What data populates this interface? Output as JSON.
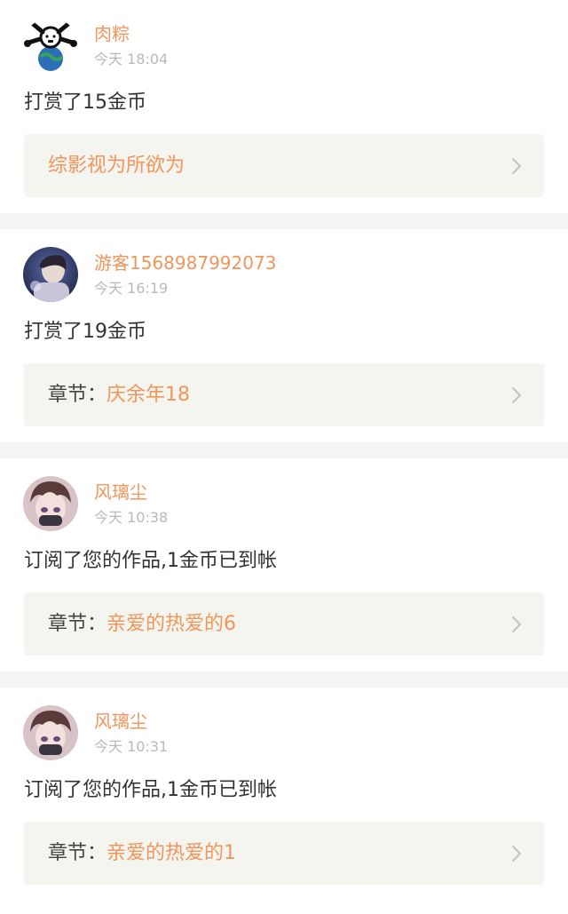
{
  "feed": [
    {
      "user": "肉粽",
      "time": "今天 18:04",
      "action": "打赏了15金币",
      "link_prefix": "",
      "link_title": "综影视为所欲为",
      "avatar_icon": "cartoon-earth-avatar-icon"
    },
    {
      "user": "游客1568987992073",
      "time": "今天 16:19",
      "action": "打赏了19金币",
      "link_prefix": "章节：",
      "link_title": "庆余年18",
      "avatar_icon": "portrait-avatar-icon"
    },
    {
      "user": "风璃尘",
      "time": "今天 10:38",
      "action": "订阅了您的作品,1金币已到帐",
      "link_prefix": "章节：",
      "link_title": "亲爱的热爱的6",
      "avatar_icon": "anime-avatar-icon"
    },
    {
      "user": "风璃尘",
      "time": "今天 10:31",
      "action": "订阅了您的作品,1金币已到帐",
      "link_prefix": "章节：",
      "link_title": "亲爱的热爱的1",
      "avatar_icon": "anime-avatar-icon"
    }
  ],
  "colors": {
    "accent": "#f0955c",
    "text": "#333333",
    "muted": "#b9b9b9",
    "link_bg": "#f5f5ef",
    "divider": "#f5f5f5"
  }
}
